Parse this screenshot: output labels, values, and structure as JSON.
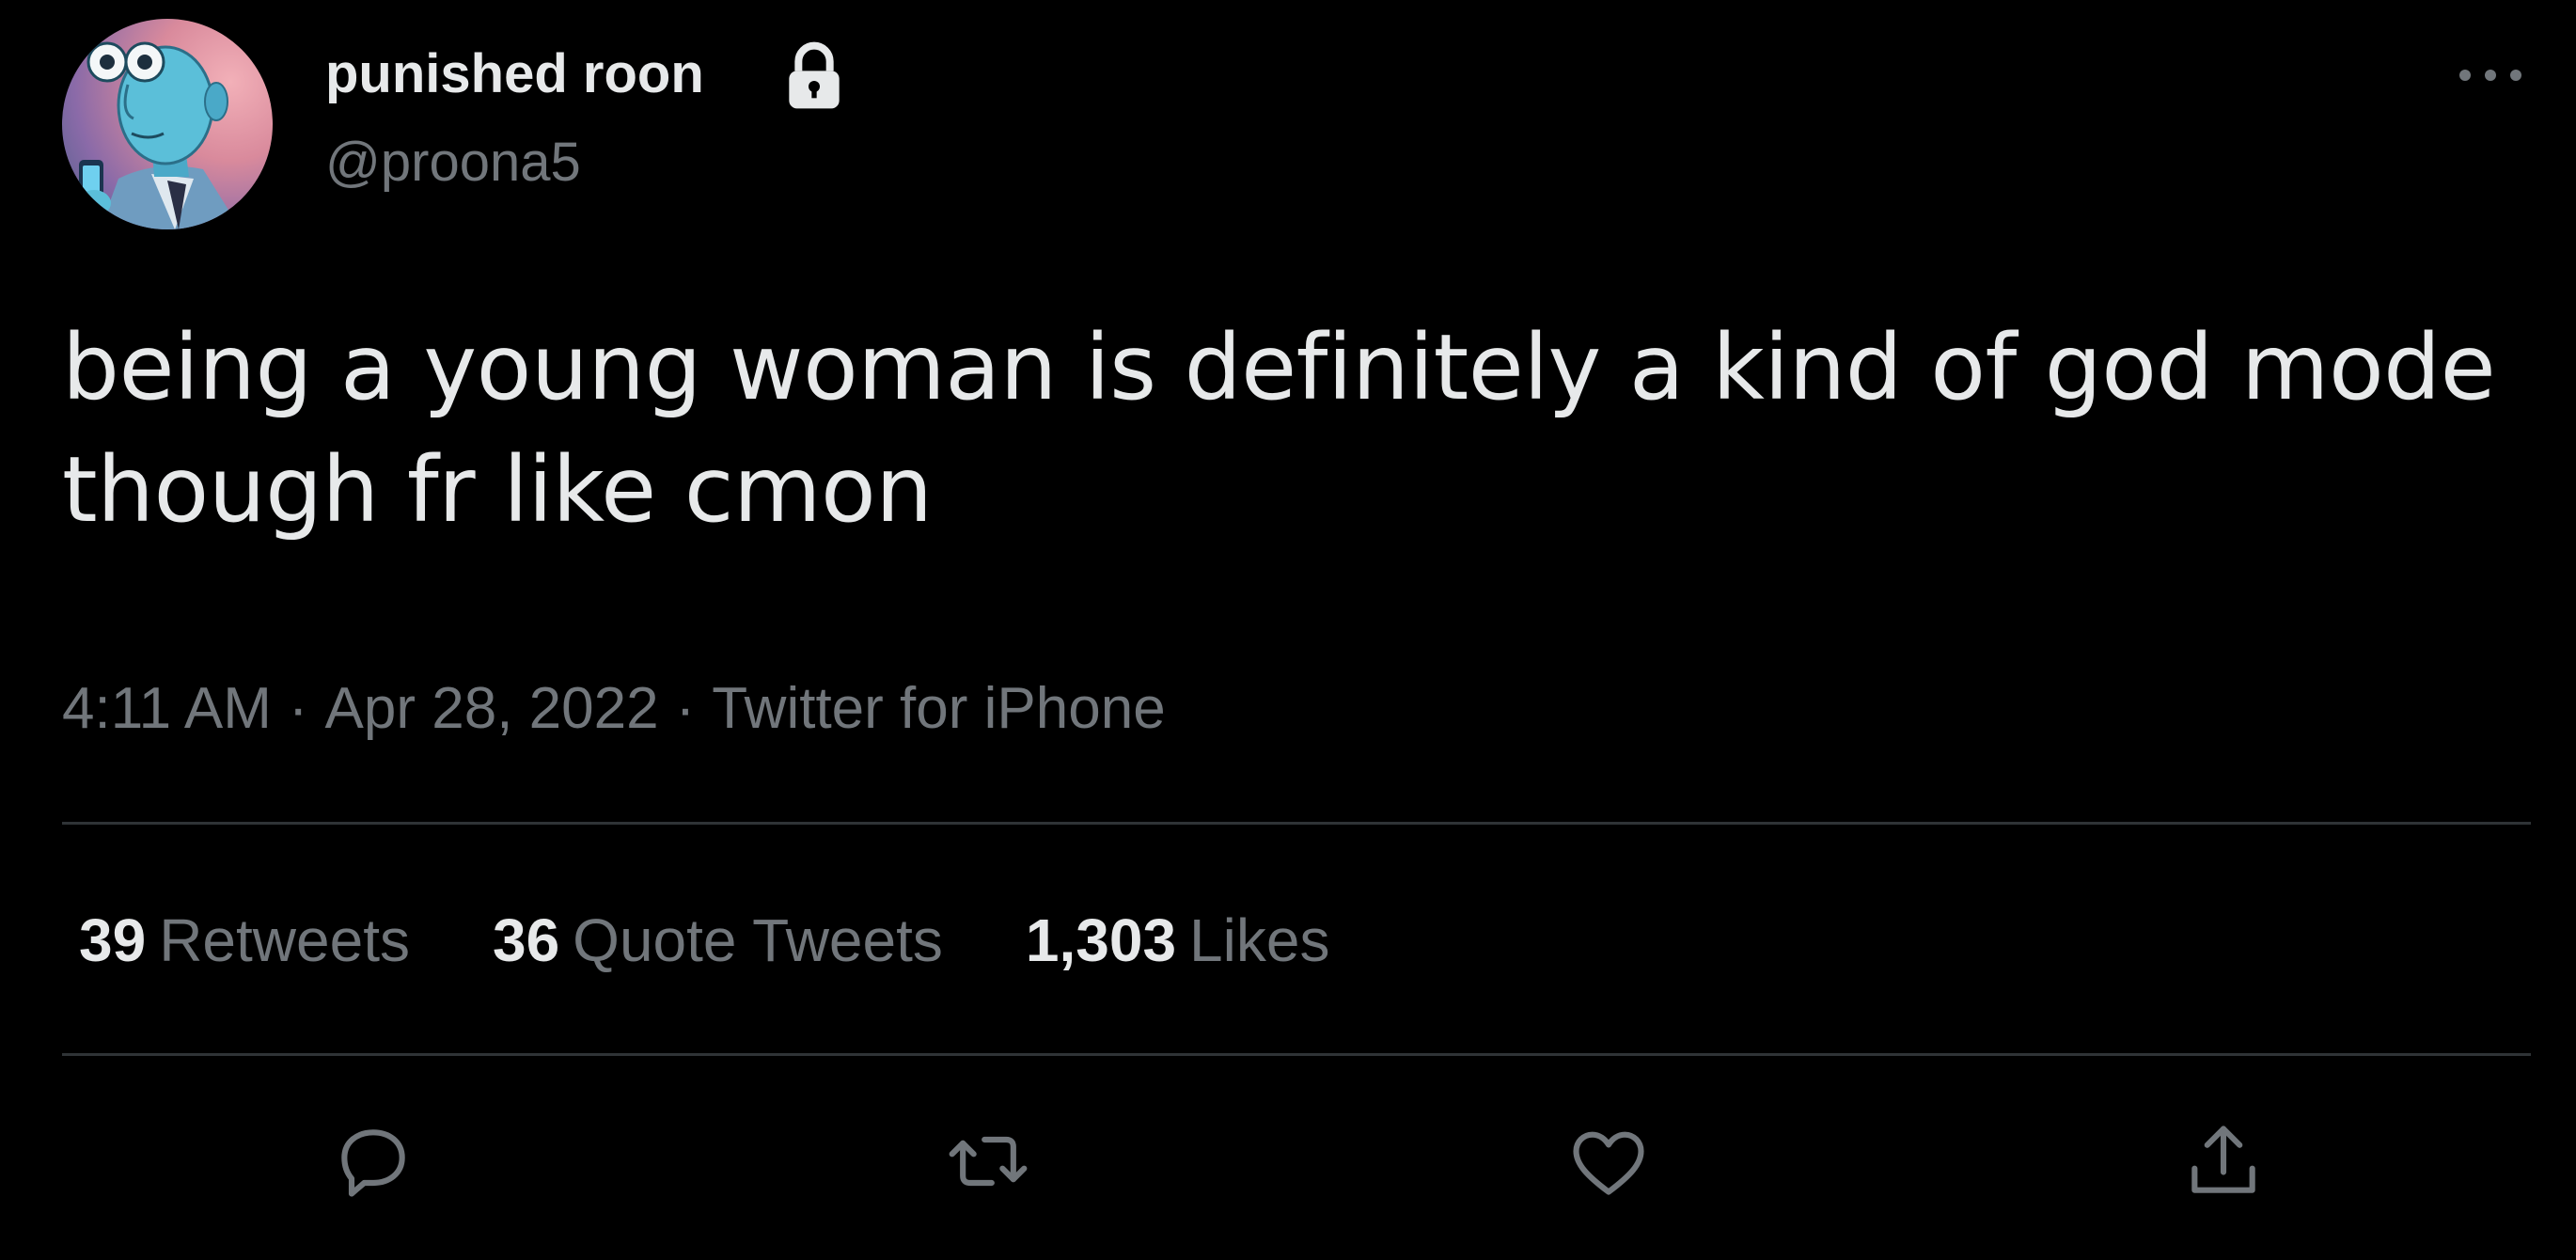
{
  "author": {
    "display_name": "punished roon",
    "handle": "@proona5",
    "protected_icon": "lock-icon",
    "avatar_icon": "avatar"
  },
  "tweet": {
    "text": "being a young woman is definitely a kind of god mode though fr like cmon",
    "time": "4:11 AM",
    "date": "Apr 28, 2022",
    "source": "Twitter for iPhone",
    "separator": "·"
  },
  "stats": {
    "retweets": {
      "count": "39",
      "label": "Retweets"
    },
    "quote_tweets": {
      "count": "36",
      "label": "Quote Tweets"
    },
    "likes": {
      "count": "1,303",
      "label": "Likes"
    }
  },
  "actions": [
    "reply-icon",
    "retweet-icon",
    "like-icon",
    "share-icon"
  ],
  "colors": {
    "background": "#000000",
    "primary_text": "#e7e9ea",
    "secondary_text": "#71767b",
    "divider": "#2f3336"
  }
}
